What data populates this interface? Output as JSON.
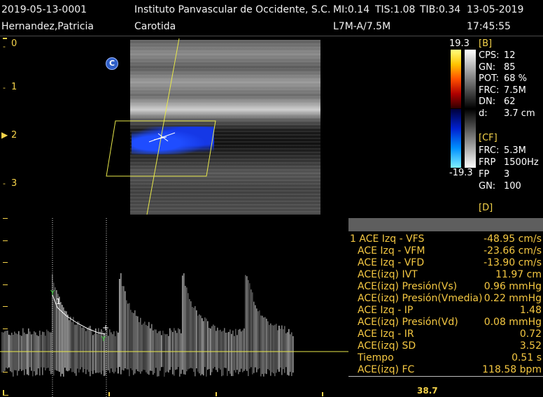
{
  "header": {
    "patient_id": "2019-05-13-0001",
    "institution": "Instituto Panvascular de Occidente, S.C.",
    "mi": "MI:0.14",
    "tis": "TIS:1.08",
    "tib": "TIB:0.34",
    "date": "13-05-2019",
    "patient_name": "Hernandez,Patricia",
    "study": "Carotida",
    "probe": "L7M-A/7.5M",
    "time": "17:45:55"
  },
  "depth_scale": [
    "0",
    "1",
    "2",
    "3"
  ],
  "mode_badge": "C",
  "colorbar": {
    "max": "19.3",
    "min": "-19.3"
  },
  "params": {
    "b_title": "[B]",
    "b": [
      {
        "k": "CPS:",
        "v": "12"
      },
      {
        "k": "GN:",
        "v": "85"
      },
      {
        "k": "POT:",
        "v": "68 %"
      },
      {
        "k": "FRC:",
        "v": "7.5M"
      },
      {
        "k": "DN:",
        "v": "62"
      },
      {
        "k": "d:",
        "v": "3.7 cm"
      }
    ],
    "cf_title": "[CF]",
    "cf": [
      {
        "k": "FRC:",
        "v": "5.3M"
      },
      {
        "k": "FRP",
        "v": "1500Hz"
      },
      {
        "k": "FP",
        "v": "3"
      },
      {
        "k": "GN:",
        "v": "100"
      }
    ],
    "d_title": "[D]"
  },
  "measurements": [
    {
      "label": "1 ACE Izq - VFS",
      "value": "-48.95 cm/s"
    },
    {
      "label": "ACE Izq - VFM",
      "value": "-23.66 cm/s"
    },
    {
      "label": "ACE Izq - VFD",
      "value": "-13.90 cm/s"
    },
    {
      "label": "ACE(izq) IVT",
      "value": "11.97 cm"
    },
    {
      "label": "ACE(izq) Presión(Vs)",
      "value": "0.96 mmHg"
    },
    {
      "label": "ACE(izq) Presión(Vmedia)",
      "value": "0.22 mmHg"
    },
    {
      "label": "ACE Izq - IP",
      "value": "1.48"
    },
    {
      "label": "ACE(izq) Presión(Vd)",
      "value": "0.08 mmHg"
    },
    {
      "label": "ACE Izq - IR",
      "value": "0.72"
    },
    {
      "label": "ACE(izq) SD",
      "value": "3.52"
    },
    {
      "label": "Tiempo",
      "value": "0.51 s"
    },
    {
      "label": "ACE(izq) FC",
      "value": "118.58 bpm"
    }
  ],
  "spectrum": {
    "cursor_label": "1",
    "bottom_readout": "38.7"
  }
}
